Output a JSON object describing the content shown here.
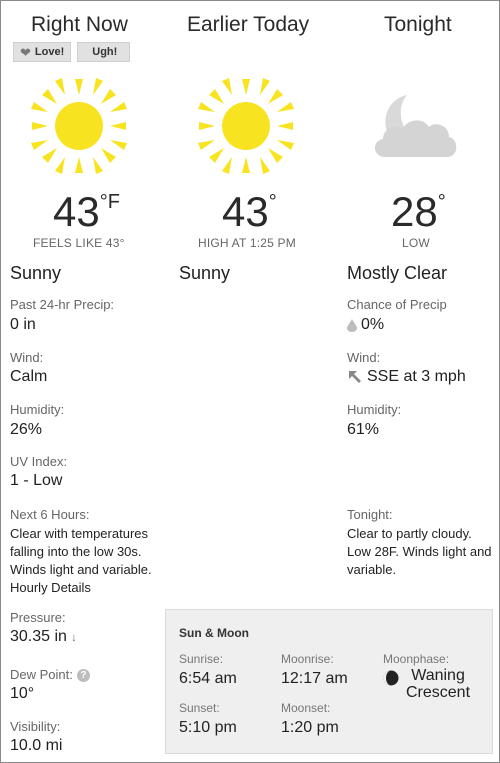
{
  "columns": {
    "right_now": {
      "title": "Right Now",
      "temperature": "43",
      "degree_unit": "°F",
      "feels_like": "FEELS LIKE 43°",
      "condition": "Sunny",
      "icon": "sun-icon"
    },
    "earlier_today": {
      "title": "Earlier Today",
      "temperature": "43",
      "degree_unit": "°",
      "high_at": "HIGH AT 1:25 PM",
      "condition": "Sunny",
      "icon": "sun-icon"
    },
    "tonight": {
      "title": "Tonight",
      "temperature": "28",
      "degree_unit": "°",
      "low_label": "LOW",
      "condition": "Mostly Clear",
      "icon": "moon-cloud-icon"
    }
  },
  "feedback": {
    "love_label": "Love!",
    "ugh_label": "Ugh!"
  },
  "right_now_details": {
    "precip_label": "Past 24-hr Precip:",
    "precip_value": "0 in",
    "wind_label": "Wind:",
    "wind_value": "Calm",
    "humidity_label": "Humidity:",
    "humidity_value": "26%",
    "uv_label": "UV Index:",
    "uv_value": "1 - Low",
    "next6_label": "Next 6 Hours:",
    "next6_text": "Clear with temperatures falling into the low 30s. Winds light and variable.",
    "hourly_details_link": "Hourly Details",
    "pressure_label": "Pressure:",
    "pressure_value": "30.35 in",
    "pressure_trend": "↓",
    "dewpoint_label": "Dew Point:",
    "dewpoint_value": "10°",
    "visibility_label": "Visibility:",
    "visibility_value": "10.0 mi"
  },
  "tonight_details": {
    "precip_chance_label": "Chance of Precip",
    "precip_chance_value": "0%",
    "wind_label": "Wind:",
    "wind_value": "SSE at 3 mph",
    "humidity_label": "Humidity:",
    "humidity_value": "61%",
    "tonight_label": "Tonight:",
    "tonight_text": "Clear to partly cloudy. Low 28F. Winds light and variable."
  },
  "sun_moon": {
    "title": "Sun & Moon",
    "sunrise_label": "Sunrise:",
    "sunrise_value": "6:54 am",
    "sunset_label": "Sunset:",
    "sunset_value": "5:10 pm",
    "moonrise_label": "Moonrise:",
    "moonrise_value": "12:17 am",
    "moonset_label": "Moonset:",
    "moonset_value": "1:20 pm",
    "moonphase_label": "Moonphase:",
    "moonphase_value_line1": "Waning",
    "moonphase_value_line2": "Crescent"
  },
  "colors": {
    "sun_core": "#f7e320",
    "sun_rays": "#f7e320",
    "moon_cloud": "#d8d8d8",
    "panel_bg": "#efefef"
  }
}
